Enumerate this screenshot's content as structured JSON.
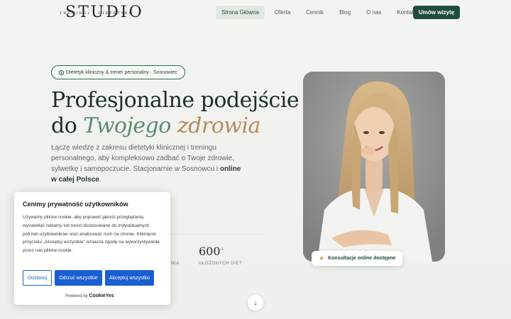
{
  "nav": {
    "logo_main": "STUDIO",
    "logo_sub": "TRENINGI I DIETETYKI",
    "items": [
      {
        "label": "Strona Główna",
        "active": true
      },
      {
        "label": "Oferta",
        "active": false
      },
      {
        "label": "Cennik",
        "active": false
      },
      {
        "label": "Blog",
        "active": false
      },
      {
        "label": "O nas",
        "active": false
      },
      {
        "label": "Kontakt",
        "active": false
      }
    ],
    "cta": "Umów wizytę"
  },
  "hero": {
    "badge": "Dietetyk kliniczny & trener personalny · Sosnowiec",
    "title_line1": "Profesjonalne podejście",
    "title_do": "do",
    "title_accent1": "Twojego",
    "title_accent2": "zdrowia",
    "lead_text": "Łączę wiedzę z zakresu dietetyki klinicznej i treningu personalnego, aby kompleksowo zadbać o Twoje zdrowie, sylwetkę i samopoczucie. Stacjonarnie w Sosnowcu i ",
    "lead_bold": "online w całej Polsce",
    "lead_end": "."
  },
  "stats": {
    "partial_label": "ZENIA",
    "value": "600",
    "value_suffix": "+",
    "label": "UŁOŻONYCH DIET"
  },
  "photo_badge": "Konsultacje online dostępne",
  "cookie": {
    "title": "Cenimy prywatność użytkowników",
    "text": "Używamy plików cookie, aby poprawić jakość przeglądania, wyświetlać reklamy lub treści dostosowane do indywidualnych potrzeb użytkowników oraz analizować ruch na stronie. Kliknięcie przycisku „Akceptuj wszystkie” oznacza zgodę na wykorzystywanie przez nas plików cookie.",
    "btn_customize": "Dostosuj",
    "btn_reject": "Odrzuć wszystkie",
    "btn_accept": "Akceptuj wszystko",
    "powered_by": "Powered by",
    "powered_brand": "CookieYes"
  },
  "colors": {
    "brand": "#1f4d3b",
    "accent_green": "#5b8a6f",
    "accent_gold": "#b68a5c",
    "cookie_blue": "#1a5fd0"
  }
}
